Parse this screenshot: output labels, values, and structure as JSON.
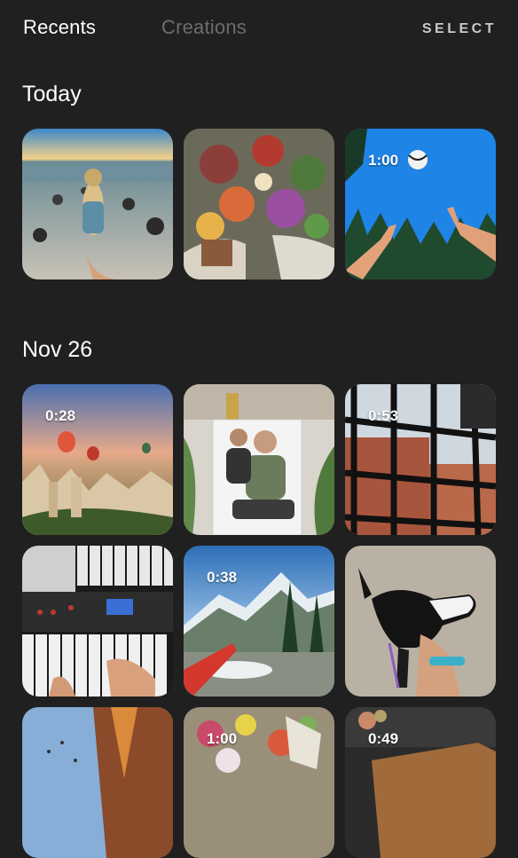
{
  "header": {
    "tabs": [
      {
        "label": "Recents",
        "active": true
      },
      {
        "label": "Creations",
        "active": false
      }
    ],
    "select_label": "SELECT"
  },
  "sections": [
    {
      "title": "Today",
      "items": [
        {
          "description_icon": "beach-photo",
          "duration": ""
        },
        {
          "description_icon": "flowers-photo",
          "duration": ""
        },
        {
          "description_icon": "volleyball-video",
          "duration": "1:00"
        }
      ]
    },
    {
      "title": "Nov 26",
      "items": [
        {
          "description_icon": "balloons-video",
          "duration": "0:28"
        },
        {
          "description_icon": "portrait-photo",
          "duration": ""
        },
        {
          "description_icon": "windows-video",
          "duration": "0:53"
        },
        {
          "description_icon": "keyboard-photo",
          "duration": ""
        },
        {
          "description_icon": "mountains-video",
          "duration": "0:38"
        },
        {
          "description_icon": "dog-photo",
          "duration": ""
        },
        {
          "description_icon": "sky-photo",
          "duration": ""
        },
        {
          "description_icon": "flowers2-video",
          "duration": "1:00"
        },
        {
          "description_icon": "table-video",
          "duration": "0:49"
        }
      ]
    }
  ],
  "colors": {
    "background": "#202020",
    "inactive_tab": "#6d6d6d",
    "select": "#c9c9c9"
  }
}
